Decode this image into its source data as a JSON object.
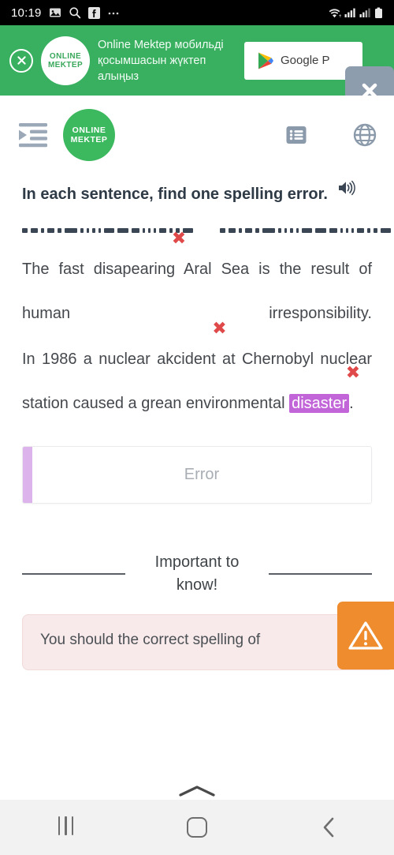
{
  "status_bar": {
    "time": "10:19",
    "left_icons": [
      "image-icon",
      "search-icon",
      "facebook-icon",
      "more-icon"
    ],
    "right_icons": [
      "wifi-icon",
      "signal-icon-1",
      "signal-icon-2",
      "battery-icon"
    ]
  },
  "promo_banner": {
    "close_label": "×",
    "logo_line1": "ONLINE",
    "logo_line2": "MEKTEP",
    "text": "Online Mektep мобильді қосымшасын жүктеп алыңыз",
    "store_button_label": "Google P",
    "overlay_close_label": "✖",
    "background_color": "#38b060"
  },
  "app_header": {
    "menu_icon": "indent-menu-icon",
    "logo_line1": "ONLINE",
    "logo_line2": "MEKTEP",
    "list_icon": "list-icon",
    "globe_icon": "globe-icon",
    "logo_color": "#3cb95e"
  },
  "question": {
    "title": "In each sentence, find one spelling error.",
    "audio_icon": "speaker-icon",
    "sentence1": {
      "before": "The  fast  ",
      "error_word": "disapearing",
      "after": "  Aral  Sea  is  the  result  of  human  irresponsibility.",
      "x_mark": "✖"
    },
    "sentence2": {
      "part1_before": "In  1986  a  nuclear  ",
      "part1_error": "akcident",
      "part1_after": "  at  Chernobyl  nuclear  station  caused  a  grean  environmental  ",
      "highlighted_word": "disaster",
      "trailing": ".",
      "x_mark": "✖",
      "highlight_color": "#c165d8"
    }
  },
  "answer": {
    "placeholder": "Error",
    "value": "",
    "accent_color": "#ddb3ec"
  },
  "important": {
    "label": "Important to know!",
    "notice_text": "You should the correct spelling of",
    "badge_icon": "warning-triangle-icon",
    "badge_color": "#ef8c2e"
  },
  "bottom": {
    "expand_handle_icon": "chevron-up-icon",
    "recents_icon": "recents-icon",
    "home_icon": "home-icon",
    "back_icon": "back-icon"
  }
}
